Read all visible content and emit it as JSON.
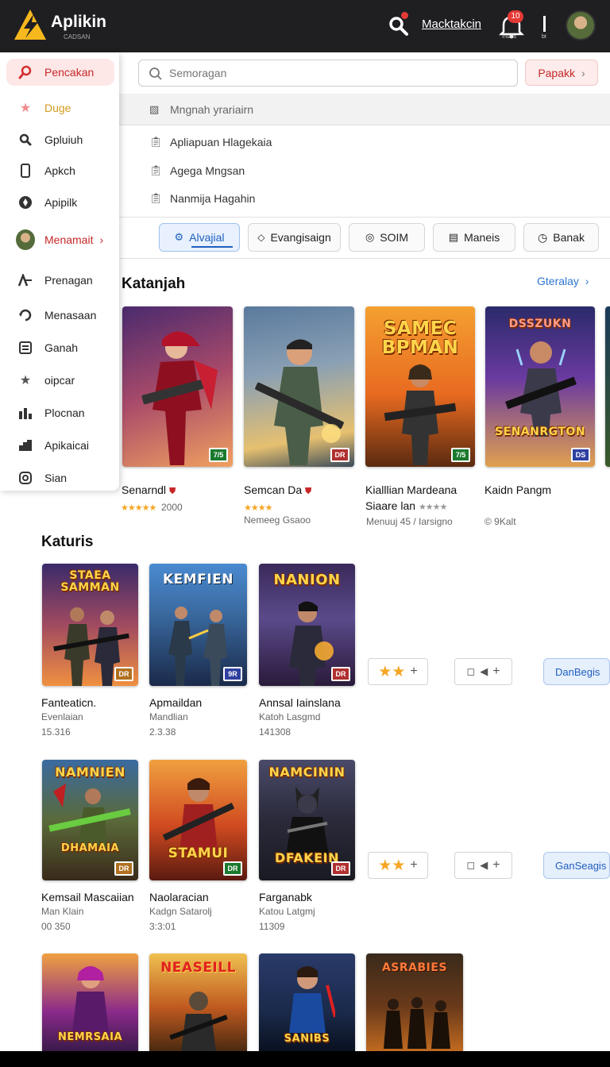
{
  "app": {
    "name": "Aplikin",
    "logo_sub": "CADSAN"
  },
  "topbar": {
    "link_label": "Macktakcin",
    "notif_count": "10",
    "notif_label": "Intalls",
    "divider_label": "bt"
  },
  "sidebar": {
    "items": [
      {
        "label": "Pencakan",
        "icon": "search-icon"
      },
      {
        "label": "Duge",
        "icon": "star-icon"
      },
      {
        "label": "Gpluiuh",
        "icon": "search-icon"
      },
      {
        "label": "Apkch",
        "icon": "phone-icon"
      },
      {
        "label": "Apipilk",
        "icon": "compass-icon"
      },
      {
        "label": "Menamait",
        "icon": "avatar"
      },
      {
        "label": "Prenagan",
        "icon": "shapes-icon"
      },
      {
        "label": "Menasaan",
        "icon": "refresh-icon"
      },
      {
        "label": "Ganah",
        "icon": "list-icon"
      },
      {
        "label": "oipcar",
        "icon": "star-icon"
      },
      {
        "label": "Plocnan",
        "icon": "chart-icon"
      },
      {
        "label": "Apikaicai",
        "icon": "chart-icon"
      },
      {
        "label": "Sian",
        "icon": "circle-icon"
      }
    ]
  },
  "search": {
    "placeholder": "Semoragan",
    "button_label": "Papakk"
  },
  "suggestions": {
    "header": "Mngnah yrariairn",
    "items": [
      "Apliapuan Hlagekaia",
      "Agega Mngsan",
      "Nanmija Hagahin"
    ]
  },
  "chips": [
    {
      "label": "Alvajial",
      "icon": "gear-icon",
      "active": true
    },
    {
      "label": "Evangisaign",
      "icon": "diamond-icon",
      "active": false
    },
    {
      "label": "SOIM",
      "icon": "ring-icon",
      "active": false
    },
    {
      "label": "Maneis",
      "icon": "grid-icon",
      "active": false
    },
    {
      "label": "Banak",
      "icon": "clock-icon",
      "active": false
    }
  ],
  "section1": {
    "title": "Katanjah",
    "see_all": "Gteralay",
    "cards": [
      {
        "name": "Senarndl",
        "sub": "2000",
        "art": "",
        "rating": "7/5"
      },
      {
        "name": "Semcan Da",
        "sub": "Nemeeg Gsaoo",
        "art": "",
        "rating": "DR"
      },
      {
        "name": "Kialllian Mardeana",
        "name2": "Siaare lan",
        "sub": "Menuuj 45 / Iarsigno",
        "art": "SAMEC BPMAN",
        "rating": "7/5"
      },
      {
        "name": "Kaidn Pangm",
        "sub": "© 9Kalt",
        "art": "DSSZUKN",
        "art2": "SENANRGTON",
        "rating": "DS"
      }
    ]
  },
  "section2": {
    "title": "Katuris",
    "rows": [
      {
        "cards": [
          {
            "name": "Fanteaticn.",
            "sub1": "Evenlaian",
            "sub2": "15.316",
            "art": "STAEA SAMMAN",
            "rating": "DR"
          },
          {
            "name": "Apmaildan",
            "sub1": "Mandlian",
            "sub2": "2.3.38",
            "art": "KEMFIEN",
            "rating": "9R"
          },
          {
            "name": "Annsal Iainslana",
            "sub1": "Katoh Lasgmd",
            "sub2": "141308",
            "art": "NANION",
            "rating": "DR"
          }
        ],
        "side_label": "DanBegis"
      },
      {
        "cards": [
          {
            "name": "Kemsail Mascaiian",
            "sub1": "Man Klain",
            "sub2": "00 350",
            "art": "NAMNIEN",
            "art2": "DHAMAIA",
            "rating": "DR"
          },
          {
            "name": "Naolaracian",
            "sub1": "Kadgn Satarolj",
            "sub2": "3:3:01",
            "art": "STAMUI",
            "rating": "DR"
          },
          {
            "name": "Farganabk",
            "sub1": "Katou Latgmj",
            "sub2": "11309",
            "art": "NAMCININ",
            "art2": "DFAKEIN",
            "rating": "DR"
          }
        ],
        "side_label": "GanSeagis"
      }
    ],
    "row3_art": [
      "NEMRSAIA",
      "NEASEILL",
      "SANIBS",
      "ASRABIES"
    ]
  }
}
